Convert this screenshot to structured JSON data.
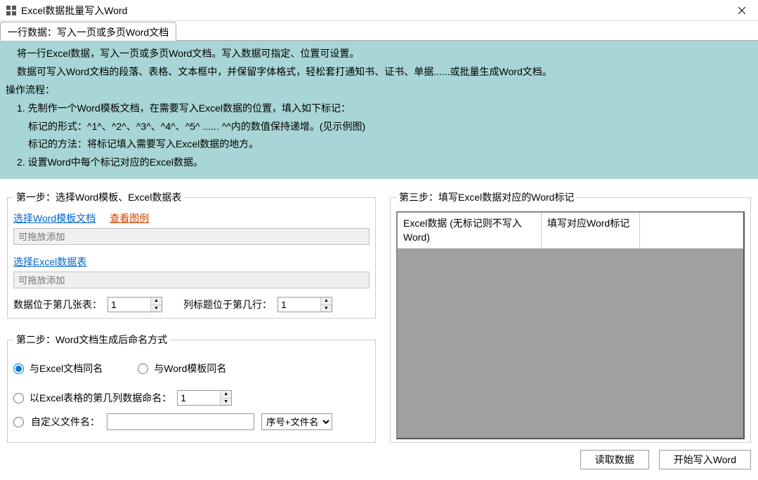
{
  "window": {
    "title": "Excel数据批量写入Word"
  },
  "tab": {
    "label": "一行数据：写入一页或多页Word文档"
  },
  "instructions": {
    "l1": "将一行Excel数据，写入一页或多页Word文档。写入数据可指定、位置可设置。",
    "l2": "数据可写入Word文档的段落、表格、文本框中，并保留字体格式，轻松套打通知书、证书、单据......或批量生成Word文档。",
    "l3": "操作流程：",
    "l4": "1. 先制作一个Word模板文档，在需要写入Excel数据的位置，填入如下标记：",
    "l5": "标记的形式：^1^、^2^、^3^、^4^、^5^ ...... ^^内的数值保持递增。(见示例图)",
    "l6": "标记的方法：将标记填入需要写入Excel数据的地方。",
    "l7": "2. 设置Word中每个标记对应的Excel数据。"
  },
  "step1": {
    "legend": "第一步：选择Word模板、Excel数据表",
    "link_template": "选择Word模板文档",
    "link_example": "查看图例",
    "placeholder_template": "可拖放添加",
    "link_excel": "选择Excel数据表",
    "placeholder_excel": "可拖放添加",
    "sheet_label": "数据位于第几张表：",
    "sheet_value": "1",
    "header_label": "列标题位于第几行：",
    "header_value": "1"
  },
  "step2": {
    "legend": "第二步：Word文档生成后命名方式",
    "opt_same_excel": "与Excel文档同名",
    "opt_same_word": "与Word模板同名",
    "opt_by_column": "以Excel表格的第几列数据命名：",
    "column_value": "1",
    "opt_custom": "自定义文件名：",
    "combo_selected": "序号+文件名"
  },
  "step3": {
    "legend": "第三步：填写Excel数据对应的Word标记",
    "col1": "Excel数据 (无标记则不写入Word)",
    "col2": "填写对应Word标记",
    "btn_read": "读取数据",
    "btn_start": "开始写入Word"
  }
}
